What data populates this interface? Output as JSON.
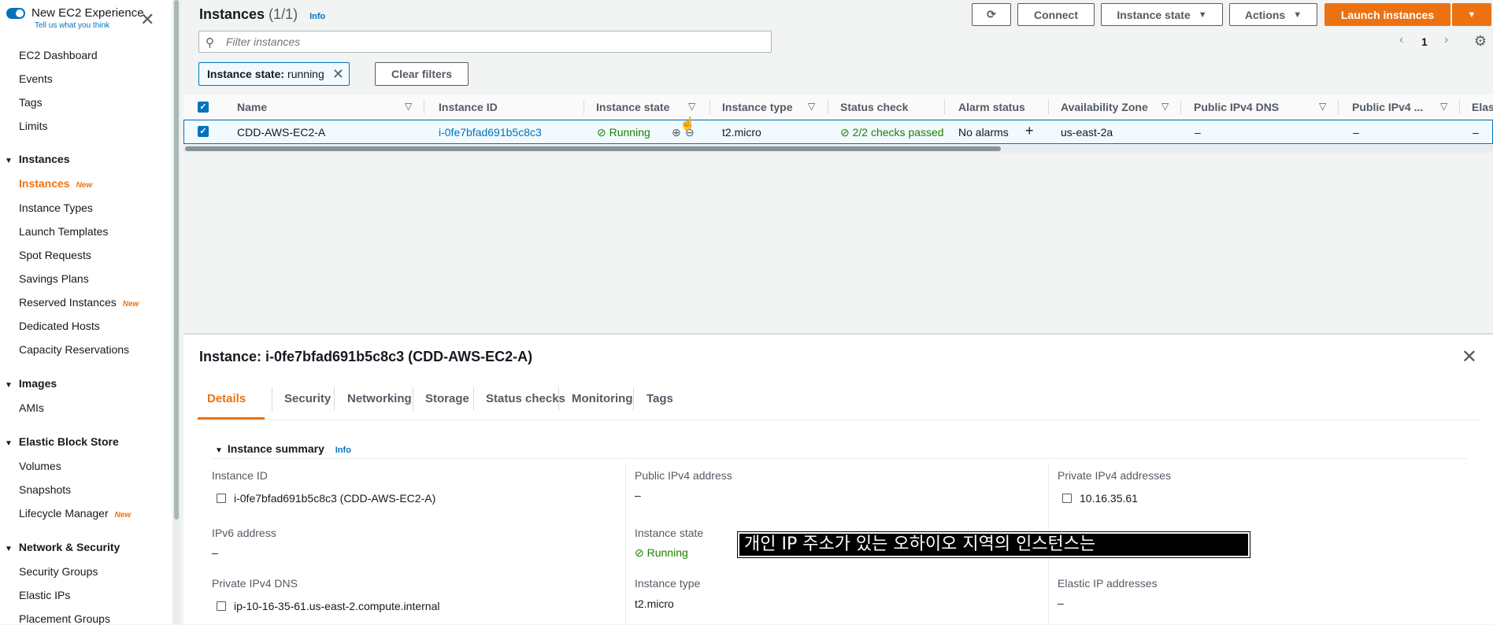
{
  "sidebar": {
    "new_experience": {
      "title": "New EC2 Experience",
      "subtitle": "Tell us what you think"
    },
    "items_top": [
      "EC2 Dashboard",
      "Events",
      "Tags",
      "Limits"
    ],
    "sections": [
      {
        "title": "Instances",
        "items": [
          {
            "label": "Instances",
            "badge": "New",
            "active": true
          },
          {
            "label": "Instance Types"
          },
          {
            "label": "Launch Templates"
          },
          {
            "label": "Spot Requests"
          },
          {
            "label": "Savings Plans"
          },
          {
            "label": "Reserved Instances",
            "badge": "New"
          },
          {
            "label": "Dedicated Hosts"
          },
          {
            "label": "Capacity Reservations"
          }
        ]
      },
      {
        "title": "Images",
        "items": [
          {
            "label": "AMIs"
          }
        ]
      },
      {
        "title": "Elastic Block Store",
        "items": [
          {
            "label": "Volumes"
          },
          {
            "label": "Snapshots"
          },
          {
            "label": "Lifecycle Manager",
            "badge": "New"
          }
        ]
      },
      {
        "title": "Network & Security",
        "items": [
          {
            "label": "Security Groups"
          },
          {
            "label": "Elastic IPs"
          },
          {
            "label": "Placement Groups"
          }
        ]
      }
    ]
  },
  "header": {
    "title": "Instances",
    "count": "(1/1)",
    "info": "Info",
    "buttons": {
      "connect": "Connect",
      "instance_state": "Instance state",
      "actions": "Actions",
      "launch": "Launch instances"
    }
  },
  "search": {
    "placeholder": "Filter instances"
  },
  "pager": {
    "page": "1"
  },
  "filter": {
    "key": "Instance state:",
    "value": "running",
    "clear": "Clear filters"
  },
  "table": {
    "columns": [
      "Name",
      "Instance ID",
      "Instance state",
      "Instance type",
      "Status check",
      "Alarm status",
      "Availability Zone",
      "Public IPv4 DNS",
      "Public IPv4 ...",
      "Elast"
    ],
    "row": {
      "name": "CDD-AWS-EC2-A",
      "instance_id": "i-0fe7bfad691b5c8c3",
      "state": "Running",
      "type": "t2.micro",
      "status_check": "2/2 checks passed",
      "alarm": "No alarms",
      "az": "us-east-2a",
      "public_dns": "–",
      "public_ipv4": "–",
      "elastic": "–"
    }
  },
  "detail": {
    "title": "Instance: i-0fe7bfad691b5c8c3 (CDD-AWS-EC2-A)",
    "tabs": [
      "Details",
      "Security",
      "Networking",
      "Storage",
      "Status checks",
      "Monitoring",
      "Tags"
    ],
    "summary_title": "Instance summary",
    "summary_info": "Info",
    "fields": {
      "instance_id_label": "Instance ID",
      "instance_id_value": "i-0fe7bfad691b5c8c3 (CDD-AWS-EC2-A)",
      "public_ipv4_label": "Public IPv4 address",
      "public_ipv4_value": "–",
      "private_ipv4_label": "Private IPv4 addresses",
      "private_ipv4_value": "10.16.35.61",
      "ipv6_label": "IPv6 address",
      "ipv6_value": "–",
      "state_label": "Instance state",
      "state_value": "Running",
      "private_dns_label": "Private IPv4 DNS",
      "private_dns_value": "ip-10-16-35-61.us-east-2.compute.internal",
      "type_label": "Instance type",
      "type_value": "t2.micro",
      "elastic_label": "Elastic IP addresses",
      "elastic_value": "–"
    }
  },
  "subtitle": "개인 IP 주소가 있는 오하이오 지역의 인스턴스는",
  "colors": {
    "accent": "#ec7211",
    "link": "#0073bb",
    "success": "#1d8102"
  }
}
